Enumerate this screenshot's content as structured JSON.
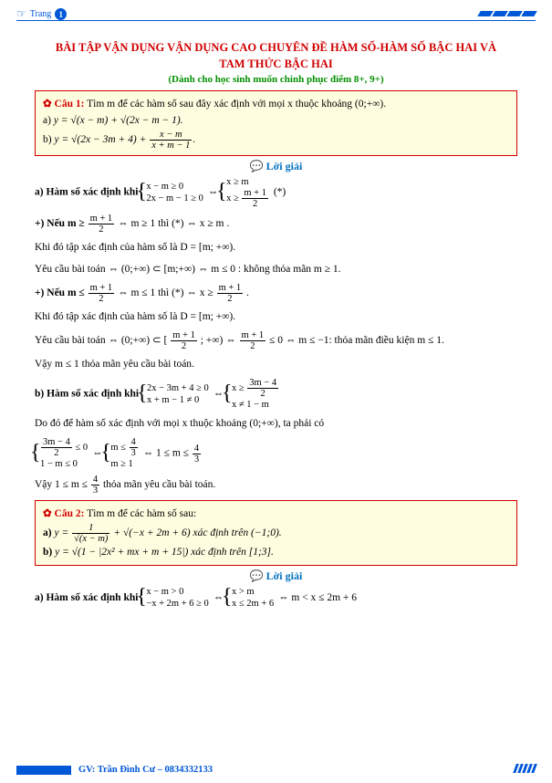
{
  "page": {
    "label": "Trang",
    "number": "1"
  },
  "title_line1": "BÀI TẬP VẬN DỤNG VẬN DỤNG CAO CHUYÊN ĐỀ HÀM SỐ-HÀM SỐ BẬC HAI VÀ",
  "title_line2": "TAM THỨC BẬC HAI",
  "subtitle": "(Dành cho học sinh muốn chinh phục điểm 8+, 9+)",
  "q1": {
    "label": "✿ Câu 1:",
    "text": "   Tìm m để các hàm số sau đây xác định với mọi x thuộc khoảng (0;+∞).",
    "a_label": "a) ",
    "a_expr": "y = √(x − m) + √(2x − m − 1).",
    "b_label": "b) ",
    "b_expr_pre": "y = √(2x − 3m + 4) + ",
    "b_frac_num": "x − m",
    "b_frac_den": "x + m − 1",
    "b_tail": "."
  },
  "sol_label": "Lời giải",
  "s1": {
    "a_lead": "a) Hàm số xác định khi ",
    "case1a": "x − m ≥ 0",
    "case1b": "2x − m − 1 ≥ 0",
    "equiv": " ⇔ ",
    "case2a": "x ≥ m",
    "case2b_pre": "x ≥ ",
    "frac_mp1_num": "m + 1",
    "frac_mp1_den": "2",
    "star": " (*)",
    "plus1_lead": "+) Nếu m ≥ ",
    "plus1_mid": " ⇔ m ≥ 1 thì (*) ⇔ x ≥ m .",
    "line3": "Khi đó tập xác định của hàm số là D = [m; +∞).",
    "line4": "Yêu cầu bài toán ⇔ (0;+∞) ⊂ [m;+∞) ⇔ m ≤ 0 : không thỏa mãn m ≥ 1.",
    "plus2_lead": "+) Nếu m ≤ ",
    "plus2_mid": " ⇔ m ≤ 1 thì (*) ⇔ x ≥ ",
    "plus2_tail": ".",
    "line6": "Khi đó tập xác định của hàm số là D = [m; +∞).",
    "line7_pre": "Yêu cầu bài toán ⇔ (0;+∞) ⊂ [",
    "line7_mid": "; +∞) ⇔ ",
    "line7_post": " ≤ 0 ⇔ m ≤ −1: thỏa mãn điều kiện m ≤ 1.",
    "line8": "Vậy m ≤ 1 thỏa mãn yêu cầu bài toán.",
    "b_lead": "b) Hàm số xác định khi ",
    "b_case1a": "2x − 3m + 4 ≥ 0",
    "b_case1b": "x + m − 1 ≠ 0",
    "b_case2a_pre": "x ≥ ",
    "b_frac2_num": "3m − 4",
    "b_frac2_den": "2",
    "b_case2b": "x ≠ 1 − m",
    "line10": "Do đó để hàm số xác định với mọi x thuộc khoảng (0;+∞), ta phải có",
    "c_case1a_num": "3m − 4",
    "c_case1a_den": "2",
    "c_case1a_tail": " ≤ 0",
    "c_case1b": "1 − m ≤ 0",
    "c_case2a_pre": "m ≤ ",
    "c_frac43_num": "4",
    "c_frac43_den": "3",
    "c_case2a_mid": " ⇔ 1 ≤ m ≤ ",
    "c_case2b": "m ≥ 1",
    "line12_pre": "Vậy 1 ≤ m ≤ ",
    "line12_post": " thỏa mãn yêu cầu bài toán."
  },
  "q2": {
    "label": "✿ Câu 2:",
    "text": "   Tìm m để các hàm số sau:",
    "a_label": "a) ",
    "a_pre": "y = ",
    "a_frac1_num": "1",
    "a_frac1_den": "√(x − m)",
    "a_mid": " + √(−x + 2m + 6) xác định trên (−1;0).",
    "b_label": "b) ",
    "b_expr": "y = √(1 − |2x² + mx + m + 15|) xác định trên [1;3]."
  },
  "s2": {
    "a_lead": "a) Hàm số xác định khi ",
    "case1a": "x − m > 0",
    "case1b": "−x + 2m + 6 ≥ 0",
    "case2a": "x > m",
    "case2b": "x ≤ 2m + 6",
    "tail": " ⇔ m < x ≤ 2m + 6"
  },
  "footer": {
    "text": "GV: Trần Đình Cư – 0834332133"
  }
}
